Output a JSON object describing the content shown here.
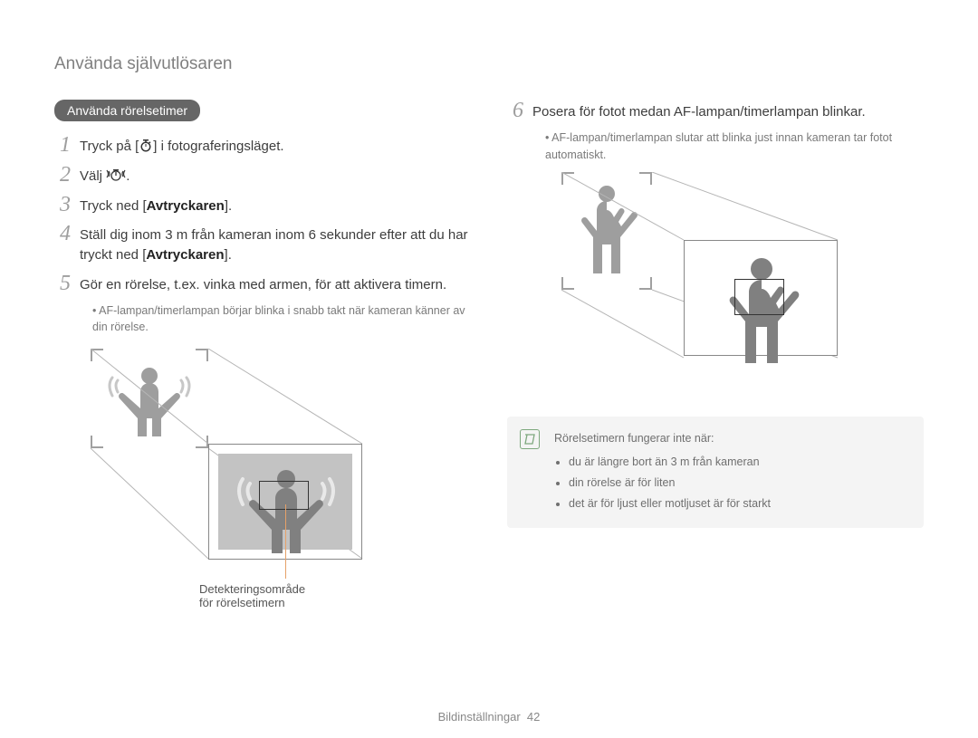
{
  "page_title": "Använda självutlösaren",
  "section_title": "Använda rörelsetimer",
  "steps": [
    {
      "n": "1",
      "pre": "Tryck på [",
      "icon": "timer-icon",
      "post": "] i fotograferingsläget."
    },
    {
      "n": "2",
      "pre": "Välj ",
      "icon": "motion-timer-icon",
      "post": "."
    },
    {
      "n": "3",
      "pre": "Tryck ned [",
      "bold": "Avtryckaren",
      "post": "]."
    },
    {
      "n": "4",
      "pre": "Ställ dig inom 3 m från kameran inom 6 sekunder efter att du har tryckt ned [",
      "bold": "Avtryckaren",
      "post": "]."
    },
    {
      "n": "5",
      "pre": "Gör en rörelse, t.ex. vinka med armen, för att aktivera timern.",
      "sub": "AF-lampan/timerlampan börjar blinka i snabb takt när kameran känner av din rörelse."
    }
  ],
  "step6": {
    "n": "6",
    "pre": "Posera för fotot medan AF-lampan/timerlampan blinkar.",
    "sub": "AF-lampan/timerlampan slutar att blinka just innan kameran tar fotot automatiskt."
  },
  "caption": {
    "line1": "Detekteringsområde",
    "line2": "för rörelsetimern"
  },
  "info": {
    "title": "Rörelsetimern fungerar inte när:",
    "items": [
      "du är längre bort än 3 m från kameran",
      "din rörelse är för liten",
      "det är för ljust eller motljuset är för starkt"
    ]
  },
  "footer": {
    "section": "Bildinställningar",
    "page": "42"
  }
}
